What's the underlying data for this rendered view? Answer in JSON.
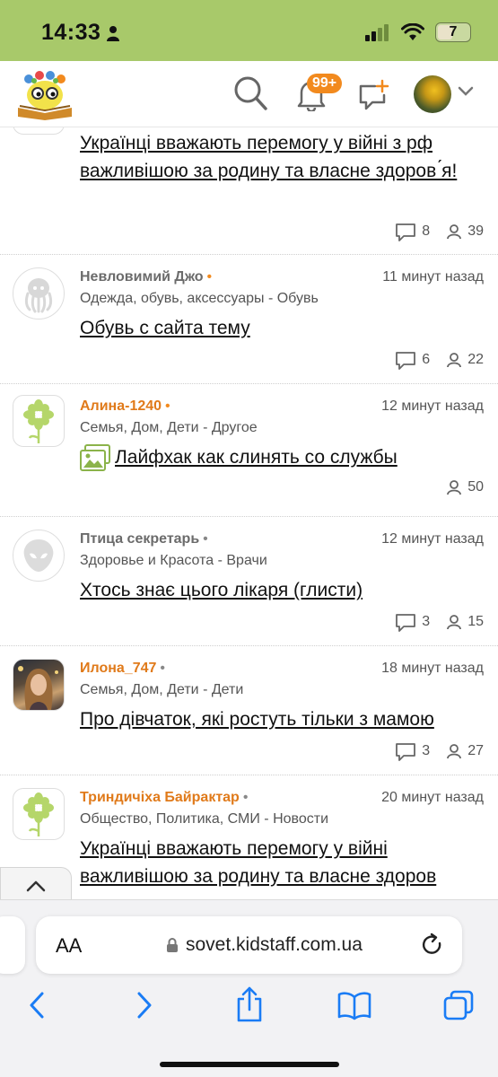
{
  "status_bar": {
    "time": "14:33",
    "battery": "7"
  },
  "header": {
    "notification_count": "99+"
  },
  "posts": [
    {
      "title": "Українці вважають перемогу у війні з рф важливішою за родину та власне здоров ́я!",
      "comments": "8",
      "views": "39"
    },
    {
      "author": "Невловимий Джо",
      "time": "11 минут назад",
      "category": "Одежда, обувь, аксессуары - Обувь",
      "title": "Обувь с сайта тему",
      "comments": "6",
      "views": "22"
    },
    {
      "author": "Алина-1240",
      "time": "12 минут назад",
      "category": "Семья, Дом, Дети - Другое",
      "title": "Лайфхак как слинять со службы",
      "views": "50"
    },
    {
      "author": "Птица секретарь",
      "time": "12 минут назад",
      "category": "Здоровье и Красота - Врачи",
      "title": "Хтось знає цього лікаря (глисти)",
      "comments": "3",
      "views": "15"
    },
    {
      "author": "Илона_747",
      "time": "18 минут назад",
      "category": "Семья, Дом, Дети - Дети",
      "title": "Про дівчаток, які ростуть тільки з мамою",
      "comments": "3",
      "views": "27"
    },
    {
      "author": "Триндичіха Байрактар",
      "time": "20 минут назад",
      "category": "Общество, Политика, СМИ - Новости",
      "title": "Українці вважають перемогу у війні важливішою за родину та власне здоров"
    }
  ],
  "browser": {
    "text_size_label": "AA",
    "url": "sovet.kidstaff.com.ua"
  },
  "colors": {
    "status_bar_bg": "#a8c96a",
    "accent_orange": "#f28a1e",
    "author_orange": "#e07a1a"
  },
  "icons": [
    "person-icon",
    "signal-icon",
    "wifi-icon",
    "battery-icon",
    "search-icon",
    "bell-icon",
    "new-message-icon",
    "chevron-down-icon",
    "comment-icon",
    "views-icon",
    "image-icon",
    "chevron-up-icon",
    "lock-icon",
    "reload-icon",
    "back-icon",
    "forward-icon",
    "share-icon",
    "bookmarks-icon",
    "tabs-icon"
  ]
}
